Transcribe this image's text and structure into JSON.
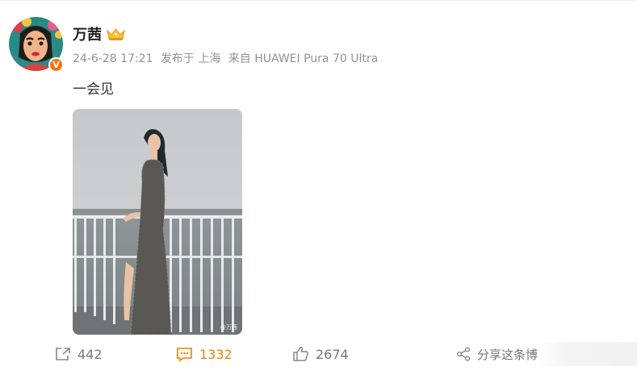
{
  "post": {
    "author": "万茜",
    "badge_letter": "V",
    "date": "24-6-28 17:21",
    "location": "发布于 上海",
    "source": "来自 HUAWEI Pura 70 Ultra",
    "text": "一会见",
    "watermark": "@万茜"
  },
  "actions": {
    "forward_count": "442",
    "comment_count": "1332",
    "like_count": "2674",
    "share_label": "分享这条博"
  },
  "colors": {
    "accent": "#f08300",
    "verified_badge": "#f3710c",
    "meta_text": "#939393"
  },
  "icons": [
    "avatar-illustration",
    "crown-icon",
    "verified-badge",
    "forward-icon",
    "comment-icon",
    "like-icon",
    "share-icon"
  ]
}
